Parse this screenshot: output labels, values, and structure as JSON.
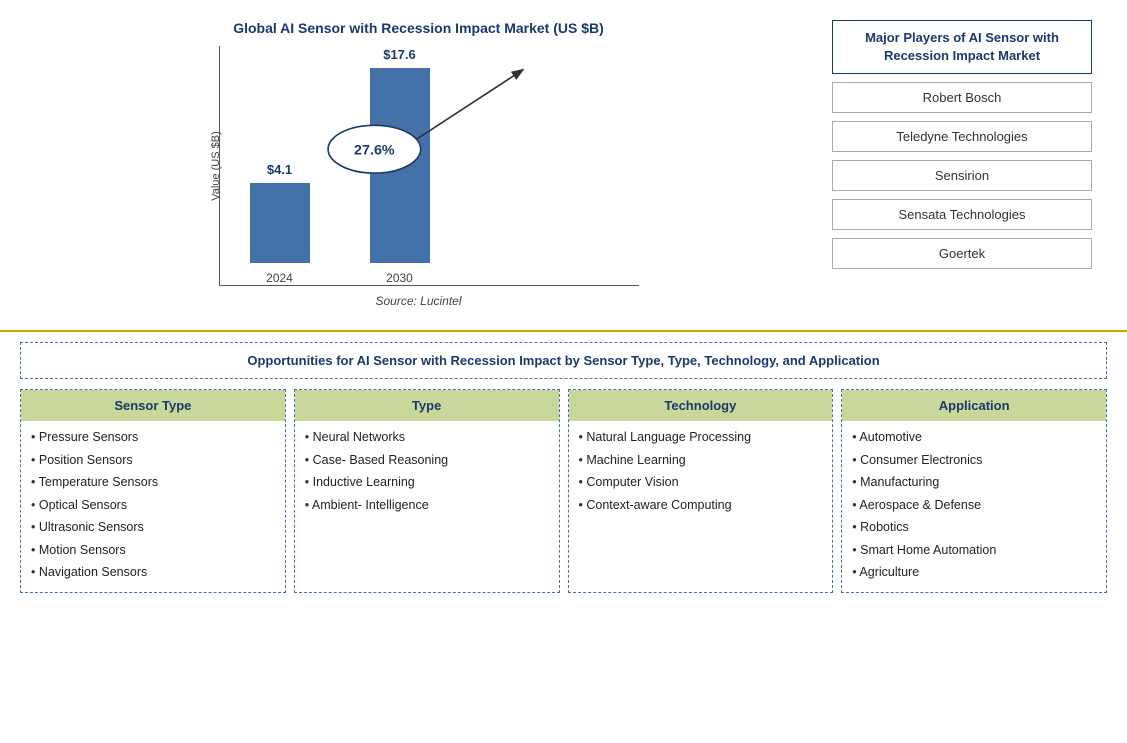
{
  "chart": {
    "title": "Global AI Sensor with Recession Impact Market (US $B)",
    "y_axis_label": "Value (US $B)",
    "source": "Source: Lucintel",
    "bars": [
      {
        "year": "2024",
        "value": "$4.1",
        "height": 80
      },
      {
        "year": "2030",
        "value": "$17.6",
        "height": 195
      }
    ],
    "cagr": "27.6%"
  },
  "major_players": {
    "title": "Major Players of AI Sensor with Recession Impact Market",
    "players": [
      "Robert Bosch",
      "Teledyne Technologies",
      "Sensirion",
      "Sensata Technologies",
      "Goertek"
    ]
  },
  "opportunities": {
    "title": "Opportunities for AI Sensor with Recession Impact by Sensor Type, Type, Technology, and Application",
    "columns": [
      {
        "header": "Sensor Type",
        "items": [
          "Pressure Sensors",
          "Position Sensors",
          "Temperature Sensors",
          "Optical Sensors",
          "Ultrasonic Sensors",
          "Motion Sensors",
          "Navigation Sensors"
        ]
      },
      {
        "header": "Type",
        "items": [
          "Neural Networks",
          "Case- Based Reasoning",
          "Inductive Learning",
          "Ambient- Intelligence"
        ]
      },
      {
        "header": "Technology",
        "items": [
          "Natural Language Processing",
          "Machine Learning",
          "Computer Vision",
          "Context-aware Computing"
        ]
      },
      {
        "header": "Application",
        "items": [
          "Automotive",
          "Consumer Electronics",
          "Manufacturing",
          "Aerospace & Defense",
          "Robotics",
          "Smart Home Automation",
          "Agriculture"
        ]
      }
    ]
  }
}
